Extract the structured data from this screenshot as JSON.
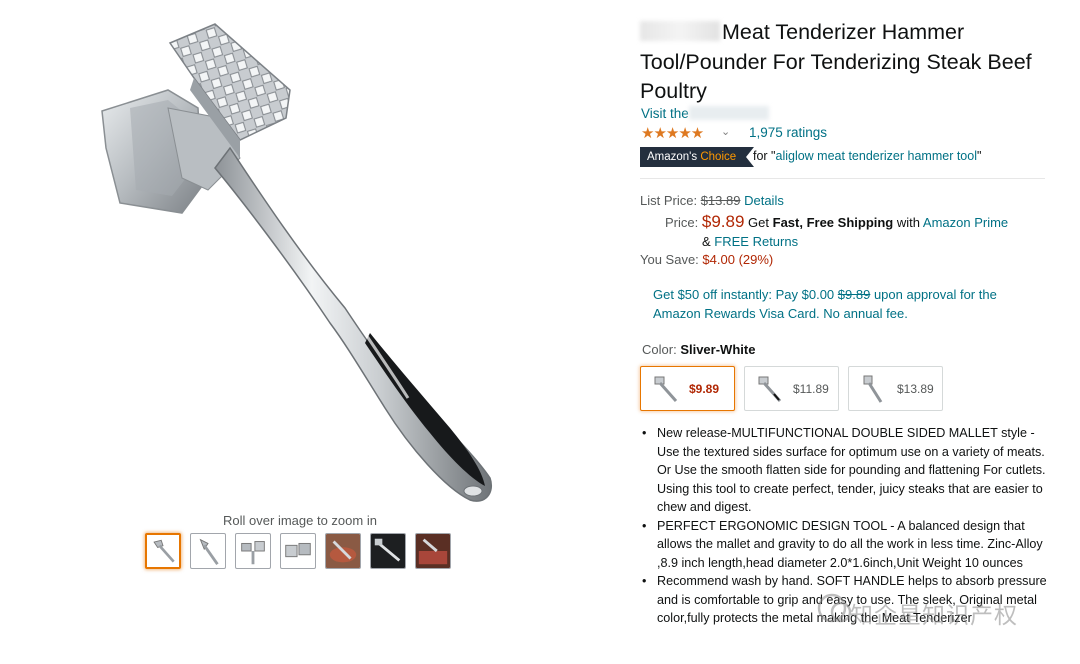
{
  "product": {
    "title": "Meat Tenderizer Hammer Tool/Pounder For Tenderizing Steak Beef Poultry",
    "store_prefix": "Visit the",
    "rating_stars": "★★★★★",
    "ratings_count": "1,975 ratings",
    "badge_amazons": "Amazon's",
    "badge_choice": "Choice",
    "choice_for": "for \"",
    "choice_query": "aliglow meat tenderizer hammer tool",
    "choice_close": "\""
  },
  "pricing": {
    "list_price_label": "List Price:",
    "list_price": "$13.89",
    "details_link": "Details",
    "price_label": "Price:",
    "price": "$9.89",
    "get_text": "Get",
    "fast_free": "Fast, Free Shipping",
    "with_text": "with",
    "prime_link": "Amazon Prime",
    "amp": "&",
    "free_returns": "FREE Returns",
    "you_save_label": "You Save:",
    "you_save": "$4.00 (29%)"
  },
  "promo": {
    "line_a": "Get $50 off instantly: Pay $0.00",
    "struck": "$9.89",
    "line_b": "upon approval for the Amazon Rewards Visa Card. No annual fee."
  },
  "variants": {
    "color_label": "Color:",
    "color_value": "Sliver-White",
    "options": [
      {
        "price": "$9.89"
      },
      {
        "price": "$11.89"
      },
      {
        "price": "$13.89"
      }
    ]
  },
  "bullets": [
    "New release-MULTIFUNCTIONAL DOUBLE SIDED MALLET style - Use the textured sides surface for optimum use on a variety of meats. Or Use the smooth flatten side for pounding and flattening For cutlets. Using this tool to create perfect, tender, juicy steaks that are easier to chew and digest.",
    "PERFECT ERGONOMIC DESIGN TOOL - A balanced design that allows the mallet and gravity to do all the work in less time. Zinc-Alloy ,8.9 inch length,head diameter 2.0*1.6inch,Unit Weight 10 ounces",
    "Recommend wash by hand. SOFT HANDLE helps to absorb pressure and is comfortable to grip and easy to use. The sleek, Original metal color,fully protects the metal making the Meat Tenderizer"
  ],
  "gallery": {
    "zoom_hint": "Roll over image to zoom in",
    "thumb_count": 7
  },
  "watermark": "知企星知识产权",
  "colors": {
    "link": "#007185",
    "price": "#b12704",
    "star": "#de7921",
    "badge_bg": "#232f3e",
    "badge_accent": "#ff9900",
    "selected_border": "#e77600"
  }
}
